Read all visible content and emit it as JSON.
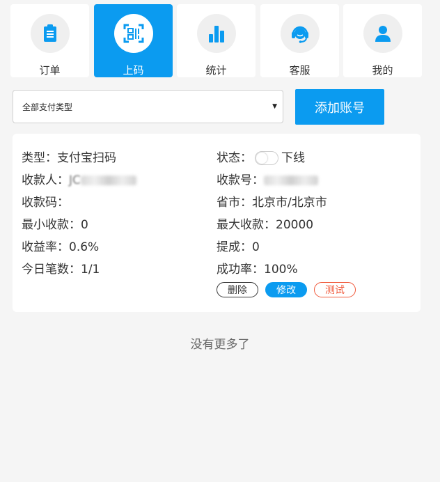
{
  "tabs": [
    {
      "label": "订单",
      "icon": "clipboard-icon",
      "active": false
    },
    {
      "label": "上码",
      "icon": "qr-scan-icon",
      "active": true
    },
    {
      "label": "统计",
      "icon": "bar-chart-icon",
      "active": false
    },
    {
      "label": "客服",
      "icon": "headset-icon",
      "active": false
    },
    {
      "label": "我的",
      "icon": "user-icon",
      "active": false
    }
  ],
  "filter": {
    "payment_type_selected": "全部支付类型",
    "add_account_label": "添加账号"
  },
  "account": {
    "type": "类型：支付宝扫码",
    "payee_prefix": "收款人：",
    "payee_visible": "JC",
    "status_prefix": "状态：",
    "status_value": "下线",
    "account_no_prefix": "收款号：",
    "qr_code": "收款码：",
    "province_city": "省市：北京市/北京市",
    "min_amount": "最小收款：0",
    "max_amount": "最大收款：20000",
    "yield_rate": "收益率：0.6%",
    "commission": "提成：0",
    "today_count": "今日笔数：1/1",
    "success_rate": "成功率：100%"
  },
  "actions": {
    "delete_label": "删除",
    "edit_label": "修改",
    "test_label": "测试"
  },
  "footer": {
    "no_more": "没有更多了"
  },
  "colors": {
    "accent": "#0b9bf0",
    "danger": "#f0583a",
    "background": "#f5f5f5"
  }
}
